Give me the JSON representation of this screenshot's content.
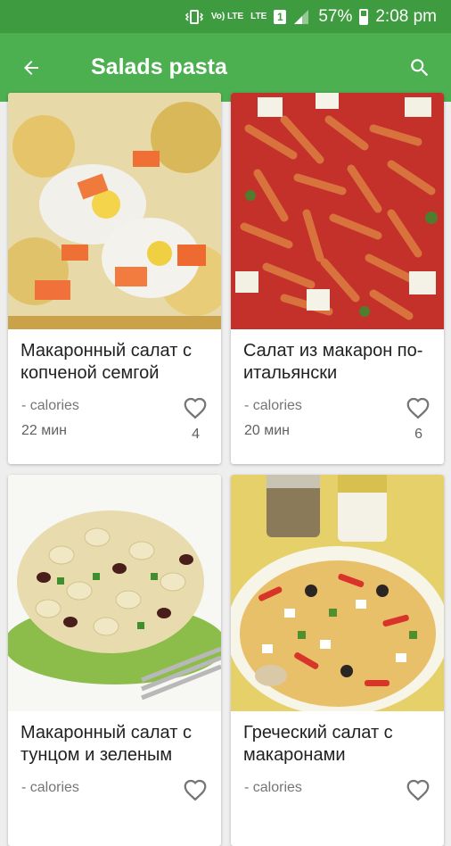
{
  "status_bar": {
    "volte": "Vo) LTE",
    "lte": "LTE",
    "sim": "1",
    "battery": "57%",
    "time": "2:08 pm"
  },
  "app_bar": {
    "title": "Salads pasta"
  },
  "recipes": [
    {
      "name": "Макаронный салат с копченой семгой",
      "calories": "- calories",
      "time": "22 мин",
      "likes": "4"
    },
    {
      "name": "Салат из макарон по-итальянски",
      "calories": "- calories",
      "time": "20 мин",
      "likes": "6"
    },
    {
      "name": "Макаронный салат с тунцом и зеленым",
      "calories": "- calories",
      "time": "",
      "likes": ""
    },
    {
      "name": "Греческий салат с макаронами",
      "calories": "- calories",
      "time": "",
      "likes": ""
    }
  ],
  "colors": {
    "status_bar": "#3f9b3f",
    "app_bar": "#4caf50",
    "background": "#eeeeee"
  }
}
